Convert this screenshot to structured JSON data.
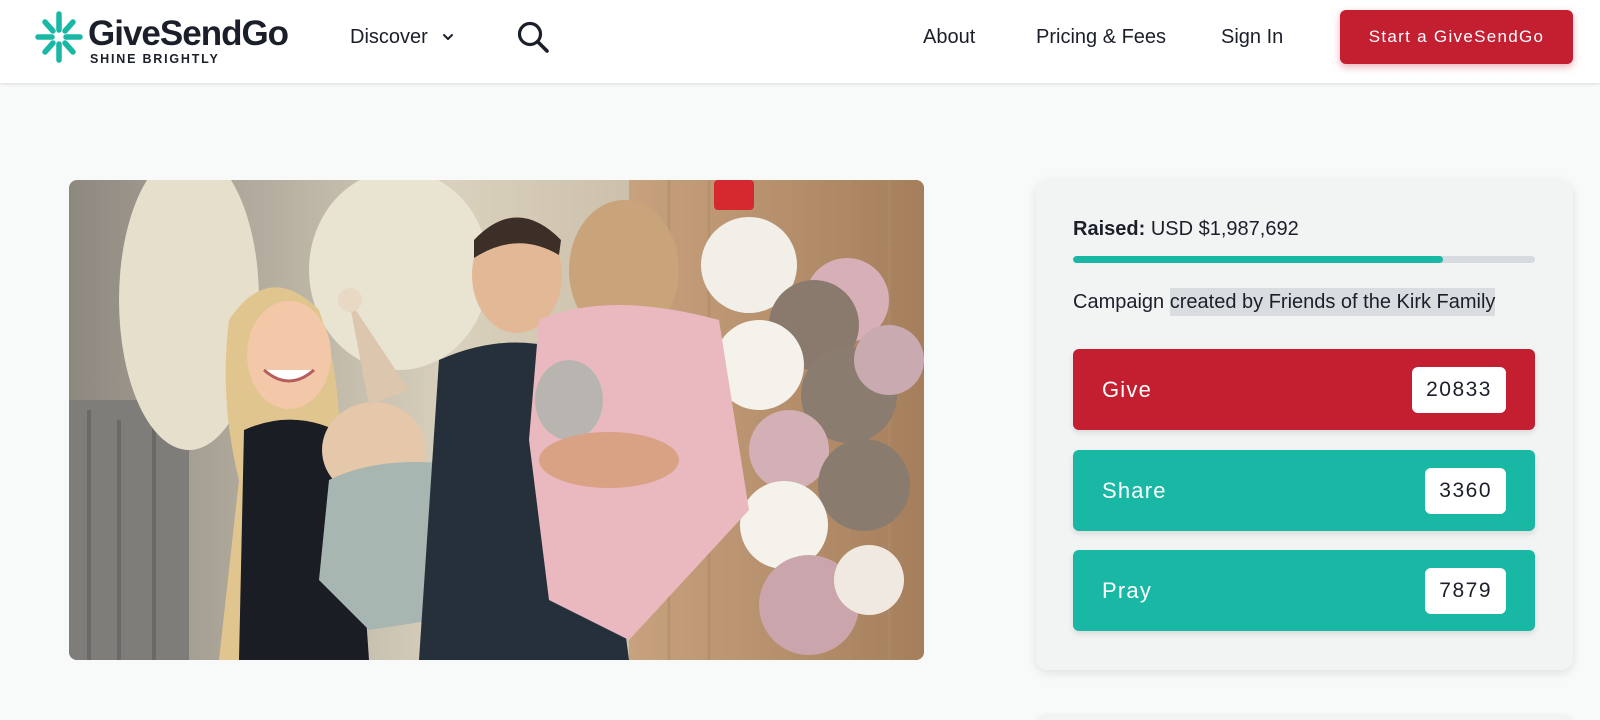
{
  "brand": {
    "name": "GiveSendGo",
    "tagline": "SHINE BRIGHTLY",
    "accent": "#19b8a4",
    "primary": "#c41e31"
  },
  "nav": {
    "discover_label": "Discover",
    "about_label": "About",
    "pricing_label": "Pricing & Fees",
    "signin_label": "Sign In",
    "start_label": "Start a GiveSendGo",
    "icons": [
      "sparkle-logo-icon",
      "chevron-down-icon",
      "search-icon"
    ]
  },
  "campaign": {
    "photo_alt": "family-photo",
    "raised_label": "Raised:",
    "raised_amount": "USD $1,987,692",
    "progress_fraction": 0.8,
    "creator_prefix": "Campaign",
    "creator_mid": "created by",
    "creator_name": "Friends of the Kirk Family"
  },
  "actions": {
    "give": {
      "label": "Give",
      "count": "20833"
    },
    "share": {
      "label": "Share",
      "count": "3360"
    },
    "pray": {
      "label": "Pray",
      "count": "7879"
    }
  }
}
